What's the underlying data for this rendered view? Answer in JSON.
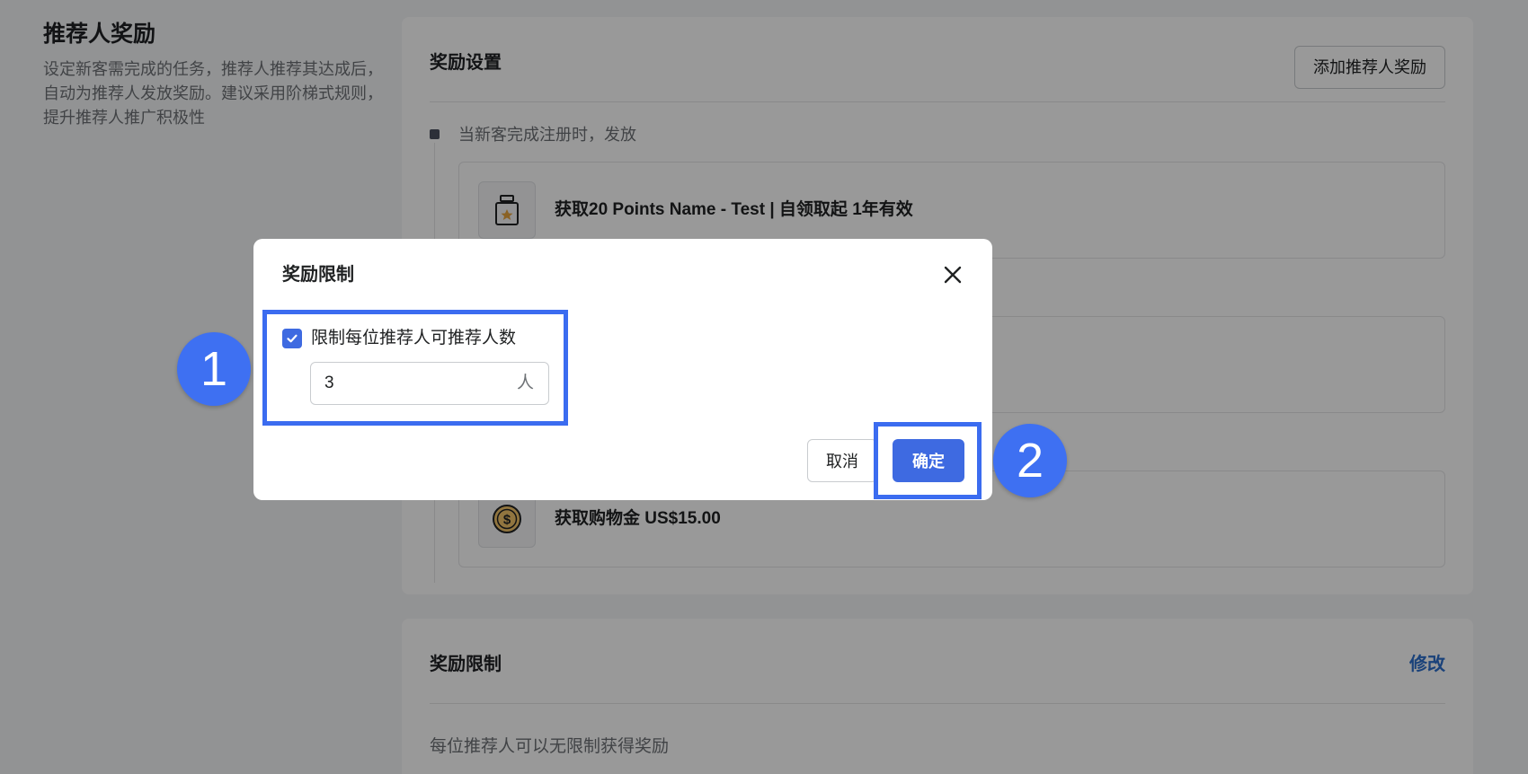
{
  "page": {
    "title": "推荐人奖励",
    "description": "设定新客需完成的任务，推荐人推荐其达成后，自动为推荐人发放奖励。建议采用阶梯式规则，提升推荐人推广积极性"
  },
  "reward_settings": {
    "title": "奖励设置",
    "add_button": "添加推荐人奖励",
    "trigger_text": "当新客完成注册时，发放",
    "rewards": [
      {
        "text": "获取20 Points Name - Test | 自领取起 1年有效",
        "icon": "gift-box-icon"
      },
      {
        "text": "",
        "icon": ""
      },
      {
        "text": "获取购物金 US$15.00",
        "icon": "coin-dollar-icon"
      }
    ]
  },
  "reward_limit": {
    "title": "奖励限制",
    "edit_link": "修改",
    "text": "每位推荐人可以无限制获得奖励"
  },
  "modal": {
    "title": "奖励限制",
    "checkbox_label": "限制每位推荐人可推荐人数",
    "checkbox_checked": true,
    "input_value": "3",
    "input_suffix": "人",
    "cancel": "取消",
    "confirm": "确定"
  },
  "annotations": {
    "badge_1": "1",
    "badge_2": "2"
  },
  "colors": {
    "primary": "#3e6ae1",
    "annotation": "#3b6cf0",
    "link": "#2c6ecb"
  }
}
